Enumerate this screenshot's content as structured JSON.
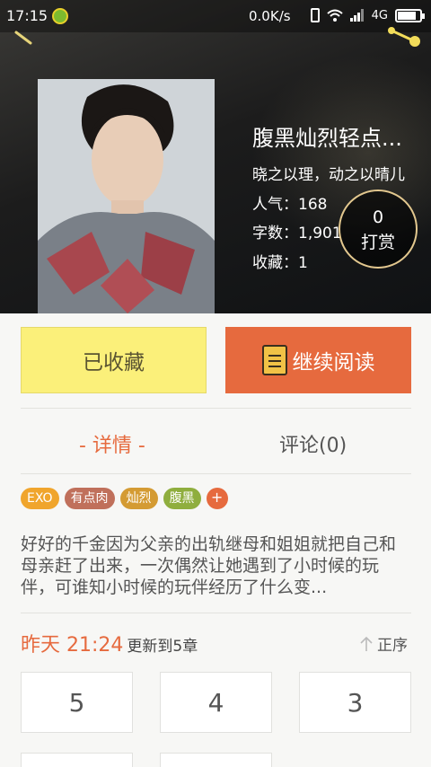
{
  "status_bar": {
    "time": "17:15",
    "net_speed": "0.0K/s",
    "network": "4G"
  },
  "book": {
    "title": "腹黑灿烈轻点...",
    "author": "晓之以理，动之以晴儿",
    "popularity": "人气：168",
    "words": "字数：1,901",
    "favorites": "收藏：1",
    "tip_count": "0",
    "tip_label": "打赏"
  },
  "actions": {
    "collected_label": "已收藏",
    "continue_label": "继续阅读"
  },
  "tabs": {
    "detail": "- 详情 -",
    "comments": "评论(0)"
  },
  "tags": [
    {
      "label": "EXO",
      "color": "#f0a52c"
    },
    {
      "label": "有点肉",
      "color": "#c0705b"
    },
    {
      "label": "灿烈",
      "color": "#d49b33"
    },
    {
      "label": "腹黑",
      "color": "#8fae3e"
    }
  ],
  "tag_add": "+",
  "synopsis": "好好的千金因为父亲的出轨继母和姐姐就把自己和母亲赶了出来，一次偶然让她遇到了小时候的玩伴，可谁知小时候的玩伴经历了什么变...",
  "update": {
    "time": "昨天 21:24",
    "text": "更新到5章",
    "order_label": "正序"
  },
  "chapters": [
    "5",
    "4",
    "3"
  ],
  "colors": {
    "accent": "#e66a3e",
    "fav_button": "#fbf07a"
  }
}
